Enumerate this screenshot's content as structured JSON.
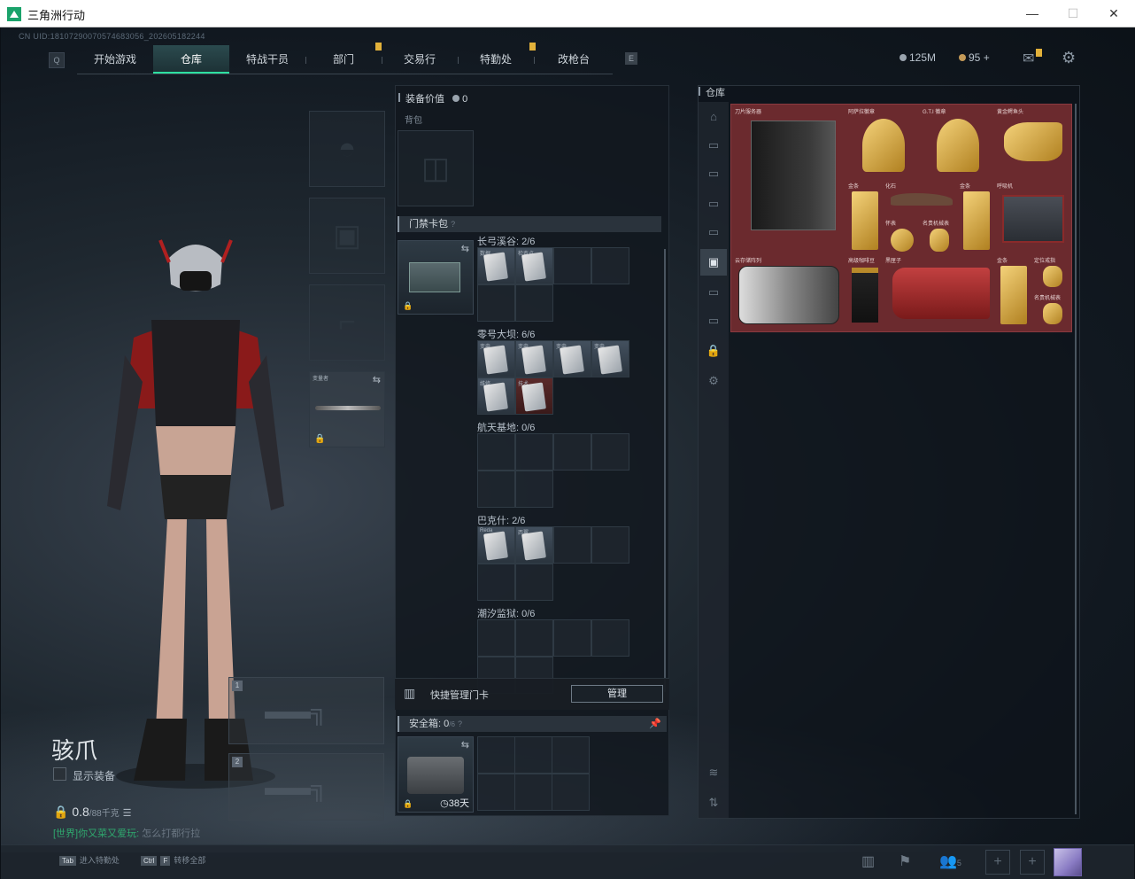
{
  "window": {
    "title": "三角洲行动"
  },
  "uid": "CN UID:18107290070574683056_202605182244",
  "nav": {
    "tabs": [
      "开始游戏",
      "仓库",
      "特战干员",
      "部门",
      "交易行",
      "特勤处",
      "改枪台"
    ],
    "active": "仓库"
  },
  "currency": {
    "money": "125M",
    "coins": "95",
    "plus": "+"
  },
  "hero": {
    "name": "骇爪",
    "show_equipment": "显示装备",
    "weight": "0.8",
    "weight_unit": "/88千克",
    "chat_channel": "[世界]",
    "chat_user": "你又菜又爱玩:",
    "chat_msg": "怎么打都行拉"
  },
  "equip": {
    "melee_label": "变量者",
    "slot1": "1",
    "slot2": "2"
  },
  "middle": {
    "equip_value_label": "装备价值",
    "equip_value": "0",
    "backpack_label": "背包",
    "keycard_header": "门禁卡包",
    "groups": [
      {
        "name": "长弓溪谷: 2/6",
        "cells": [
          {
            "n": "数据",
            "c": "filled"
          },
          {
            "n": "检查点",
            "c": "filled"
          }
        ]
      },
      {
        "name": "零号大坝: 6/6",
        "cells": [
          {
            "n": "变电",
            "c": "filled"
          },
          {
            "n": "变电",
            "c": "filled"
          },
          {
            "n": "变电",
            "c": "filled"
          },
          {
            "n": "变电",
            "c": "filled"
          },
          {
            "n": "维修",
            "c": "filled"
          },
          {
            "n": "技术",
            "c": "red"
          }
        ]
      },
      {
        "name": "航天基地: 0/6",
        "cells": []
      },
      {
        "name": "巴克什: 2/6",
        "cells": [
          {
            "n": "Reda",
            "c": "filled"
          },
          {
            "n": "西翼",
            "c": "filled"
          }
        ]
      },
      {
        "name": "潮汐监狱: 0/6",
        "cells": []
      }
    ],
    "quick_manage": "快捷管理门卡",
    "manage_btn": "管理",
    "safebox_label": "安全箱:",
    "safebox_count": "0",
    "safebox_cap": "/6",
    "safebox_days": "38天"
  },
  "warehouse": {
    "title": "仓库",
    "items": [
      {
        "name": "刀片服务器"
      },
      {
        "name": "阿萨拉徽章"
      },
      {
        "name": "G.T.I 徽章"
      },
      {
        "name": "黄金鳄鱼头"
      },
      {
        "name": "金条"
      },
      {
        "name": "化石"
      },
      {
        "name": "金条"
      },
      {
        "name": "呼吸机"
      },
      {
        "name": "怀表"
      },
      {
        "name": "名贵机械表"
      },
      {
        "name": "云存储阵列"
      },
      {
        "name": "高级咖啡豆"
      },
      {
        "name": "黑匣子"
      },
      {
        "name": "金条"
      },
      {
        "name": "定位戒指"
      },
      {
        "name": "名贵机械表"
      }
    ]
  },
  "bottom": {
    "tab_key": "Tab",
    "tab_hint": "进入特勤处",
    "ctrl_key": "Ctrl",
    "f_key": "F",
    "ctrl_hint": "转移全部",
    "friends_count": "5"
  },
  "colors": {
    "accent": "#2de0a0",
    "warehouse_bg": "#6b2a2e",
    "badge": "#e2b13a"
  }
}
